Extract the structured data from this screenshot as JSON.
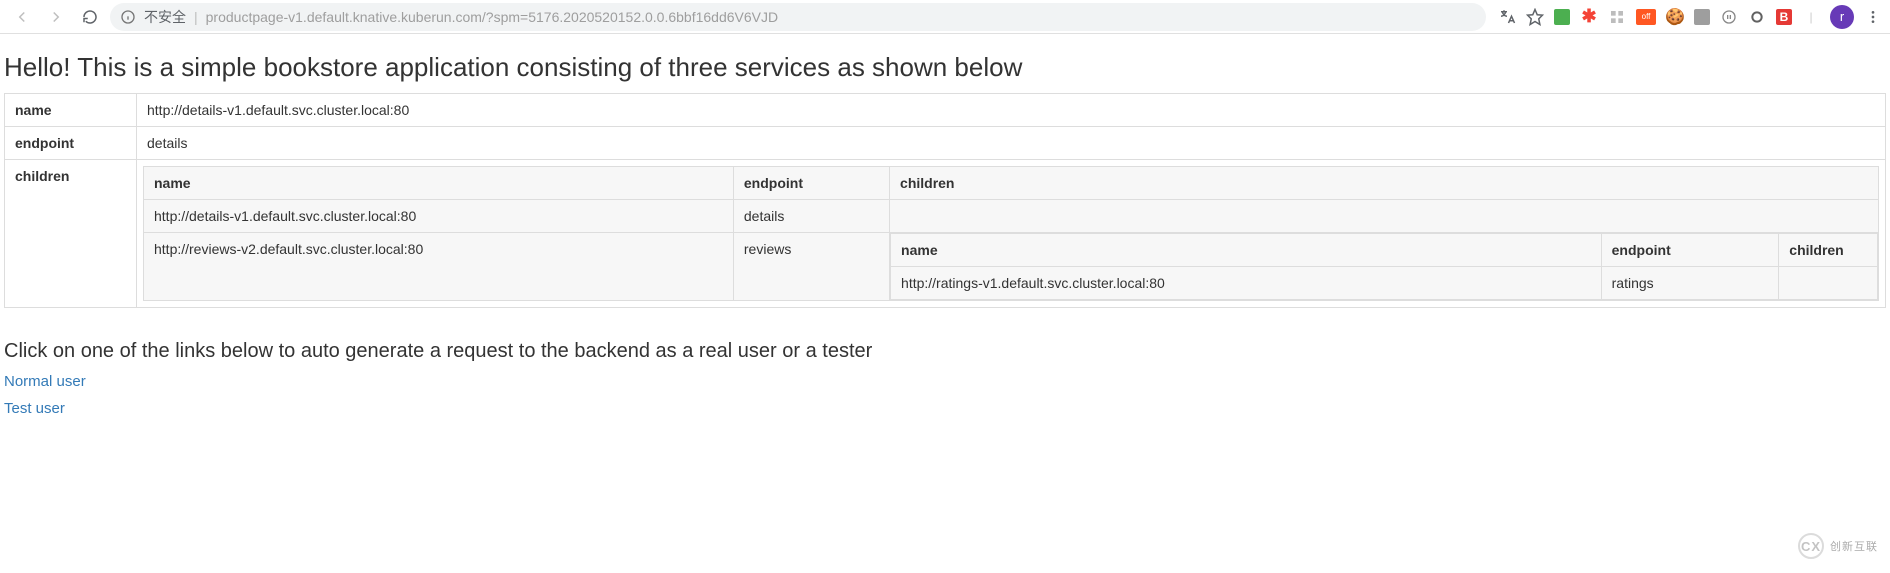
{
  "browser": {
    "insecure_label": "不安全",
    "url": "productpage-v1.default.knative.kuberun.com/?spm=5176.2020520152.0.0.6bbf16dd6V6VJD",
    "avatar_letter": "r"
  },
  "page": {
    "heading": "Hello! This is a simple bookstore application consisting of three services as shown below",
    "subheading": "Click on one of the links below to auto generate a request to the backend as a real user or a tester",
    "links": {
      "normal": "Normal user",
      "test": "Test user"
    },
    "labels": {
      "name": "name",
      "endpoint": "endpoint",
      "children": "children"
    },
    "service": {
      "name": "http://details-v1.default.svc.cluster.local:80",
      "endpoint": "details",
      "children": [
        {
          "name": "http://details-v1.default.svc.cluster.local:80",
          "endpoint": "details",
          "children": null
        },
        {
          "name": "http://reviews-v2.default.svc.cluster.local:80",
          "endpoint": "reviews",
          "children": [
            {
              "name": "http://ratings-v1.default.svc.cluster.local:80",
              "endpoint": "ratings",
              "children_label": ""
            }
          ]
        }
      ]
    }
  },
  "watermark": {
    "logo": "CX",
    "text": "创新互联"
  }
}
